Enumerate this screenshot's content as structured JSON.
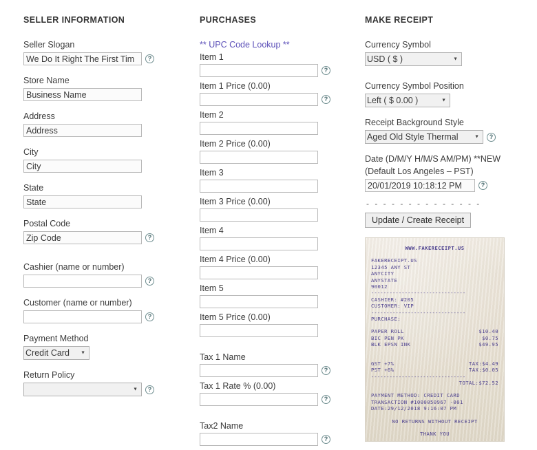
{
  "seller": {
    "title": "SELLER INFORMATION",
    "fields": [
      {
        "label": "Seller Slogan",
        "value": "We Do It Right The First Tim",
        "placeholder": "",
        "help": true
      },
      {
        "label": "Store Name",
        "value": "Business Name",
        "placeholder": "",
        "help": false
      },
      {
        "label": "Address",
        "value": "Address",
        "placeholder": "",
        "help": false
      },
      {
        "label": "City",
        "value": "City",
        "placeholder": "",
        "help": false
      },
      {
        "label": "State",
        "value": "State",
        "placeholder": "",
        "help": false
      },
      {
        "label": "Postal Code",
        "value": "Zip Code",
        "placeholder": "",
        "help": true
      },
      {
        "label": "Cashier (name or number)",
        "value": "",
        "placeholder": "",
        "help": true
      },
      {
        "label": "Customer (name or number)",
        "value": "",
        "placeholder": "",
        "help": true
      }
    ],
    "payment_method": {
      "label": "Payment Method",
      "value": "Credit Card"
    },
    "return_policy": {
      "label": "Return Policy",
      "value": ""
    }
  },
  "purchases": {
    "title": "PURCHASES",
    "upc_lookup": "** UPC Code Lookup **",
    "items": [
      {
        "label": "Item 1",
        "value": "",
        "help": true
      },
      {
        "label": "Item 1 Price (0.00)",
        "value": "",
        "help": true
      },
      {
        "label": "Item 2",
        "value": "",
        "help": false
      },
      {
        "label": "Item 2 Price (0.00)",
        "value": "",
        "help": false
      },
      {
        "label": "Item 3",
        "value": "",
        "help": false
      },
      {
        "label": "Item 3 Price (0.00)",
        "value": "",
        "help": false
      },
      {
        "label": "Item 4",
        "value": "",
        "help": false
      },
      {
        "label": "Item 4 Price (0.00)",
        "value": "",
        "help": false
      },
      {
        "label": "Item 5",
        "value": "",
        "help": false
      },
      {
        "label": "Item 5 Price (0.00)",
        "value": "",
        "help": false
      }
    ],
    "taxes": [
      {
        "label": "Tax 1 Name",
        "value": "",
        "help": true
      },
      {
        "label": "Tax 1 Rate % (0.00)",
        "value": "",
        "help": true
      },
      {
        "label": "Tax2 Name",
        "value": "",
        "help": true
      }
    ]
  },
  "make_receipt": {
    "title": "MAKE RECEIPT",
    "currency_symbol": {
      "label": "Currency Symbol",
      "value": "USD ( $ )"
    },
    "currency_position": {
      "label": "Currency Symbol Position",
      "value": "Left ( $ 0.00 )"
    },
    "background_style": {
      "label": "Receipt Background Style",
      "value": "Aged Old Style Thermal"
    },
    "date": {
      "label_line1": "Date (D/M/Y H/M/S AM/PM) **NEW",
      "label_line2": "(Default Los Angeles – PST)",
      "value": "20/01/2019 10:18:12 PM"
    },
    "divider": "- - - - - - - - - - - - - -",
    "update_button": "Update / Create Receipt"
  },
  "receipt_preview": {
    "website": "WWW.FAKERECEIPT.US",
    "store_name": "FAKERECEIPT.US",
    "address": "12345 ANY ST",
    "city": "ANYCITY",
    "state": "ANYSTATE",
    "zip": "90012",
    "separator": "-------------------------------",
    "cashier": "CASHIER: #205",
    "customer": "CUSTOMER: VIP",
    "purchase_heading": "PURCHASE:",
    "line_items": [
      {
        "name": "PAPER ROLL",
        "price": "$10.40"
      },
      {
        "name": "BIC PEN PK",
        "price": "$0.75"
      },
      {
        "name": "BLK EPSN INK",
        "price": "$49.95"
      }
    ],
    "taxes": [
      {
        "name": "GST +7%",
        "amount": "TAX:$4.49"
      },
      {
        "name": "PST +6%",
        "amount": "TAX:$0.05"
      }
    ],
    "total": "TOTAL:$72.52",
    "payment_method": "PAYMENT METHOD: CREDIT CARD",
    "transaction": "TRANSACTION #1000050967 -001",
    "date": "DATE:29/12/2018 9:16:07 PM",
    "return_notice": "NO RETURNS WITHOUT RECEIPT",
    "thank_you": "THANK YOU"
  },
  "icons": {
    "help": "?",
    "chevron_down": "▼"
  }
}
